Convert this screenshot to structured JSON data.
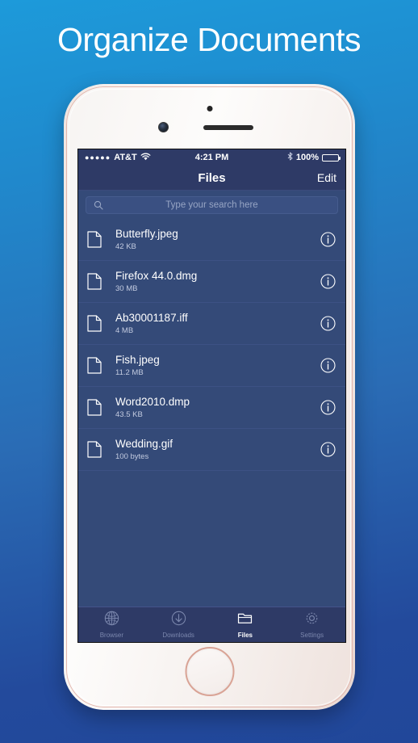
{
  "headline": "Organize Documents",
  "status_bar": {
    "signal_dots": "●●●●●",
    "carrier": "AT&T",
    "wifi_icon": "wifi-icon",
    "time": "4:21 PM",
    "bluetooth_icon": "bluetooth-icon",
    "battery_percent": "100%",
    "battery_icon": "battery-full-icon"
  },
  "nav_bar": {
    "title": "Files",
    "edit_label": "Edit"
  },
  "search": {
    "placeholder": "Type your search here",
    "value": "",
    "icon": "search-icon"
  },
  "files": [
    {
      "name": "Butterfly.jpeg",
      "size": "42 KB",
      "icon": "document-icon",
      "info_icon": "info-circle-icon"
    },
    {
      "name": "Firefox 44.0.dmg",
      "size": "30 MB",
      "icon": "document-icon",
      "info_icon": "info-circle-icon"
    },
    {
      "name": "Ab30001187.iff",
      "size": "4 MB",
      "icon": "document-icon",
      "info_icon": "info-circle-icon"
    },
    {
      "name": "Fish.jpeg",
      "size": "11.2 MB",
      "icon": "document-icon",
      "info_icon": "info-circle-icon"
    },
    {
      "name": "Word2010.dmp",
      "size": "43.5 KB",
      "icon": "document-icon",
      "info_icon": "info-circle-icon"
    },
    {
      "name": "Wedding.gif",
      "size": "100 bytes",
      "icon": "document-icon",
      "info_icon": "info-circle-icon"
    }
  ],
  "tabs": [
    {
      "label": "Browser",
      "icon": "globe-icon",
      "active": false
    },
    {
      "label": "Downloads",
      "icon": "download-arrow-icon",
      "active": false
    },
    {
      "label": "Files",
      "icon": "folder-icon",
      "active": true
    },
    {
      "label": "Settings",
      "icon": "gear-icon",
      "active": false
    }
  ],
  "colors": {
    "background_top": "#1d9ada",
    "background_bottom": "#21479a",
    "screen_bg": "#344a78",
    "chrome_bg": "#2e3a66",
    "bezel": "#f6f1ee",
    "bezel_accent": "#d9a395",
    "text_primary": "#ffffff",
    "text_secondary": "#c3cbe0",
    "text_dim": "#7b87ad"
  }
}
